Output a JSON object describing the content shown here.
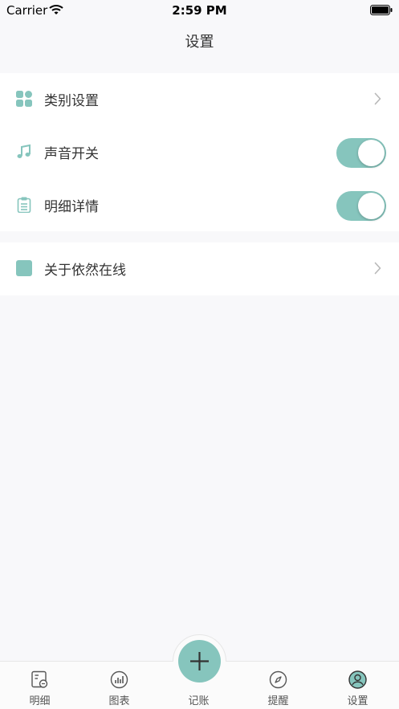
{
  "status_bar": {
    "carrier": "Carrier",
    "time": "2:59 PM"
  },
  "nav": {
    "title": "设置"
  },
  "settings": {
    "group1": [
      {
        "label": "类别设置",
        "icon": "category-grid-icon",
        "control": "chevron"
      },
      {
        "label": "声音开关",
        "icon": "music-note-icon",
        "control": "toggle",
        "value": true
      },
      {
        "label": "明细详情",
        "icon": "clipboard-icon",
        "control": "toggle",
        "value": true
      }
    ],
    "group2": [
      {
        "label": "关于依然在线",
        "icon": "square-icon",
        "control": "chevron"
      }
    ]
  },
  "tabbar": {
    "items": [
      {
        "label": "明细",
        "icon": "ledger-icon"
      },
      {
        "label": "图表",
        "icon": "chart-icon"
      },
      {
        "label": "记账",
        "icon": "plus-icon"
      },
      {
        "label": "提醒",
        "icon": "compass-icon"
      },
      {
        "label": "设置",
        "icon": "profile-icon",
        "active": true
      }
    ]
  },
  "colors": {
    "accent": "#86c5bd",
    "background": "#f8f8fa",
    "text": "#333333"
  }
}
